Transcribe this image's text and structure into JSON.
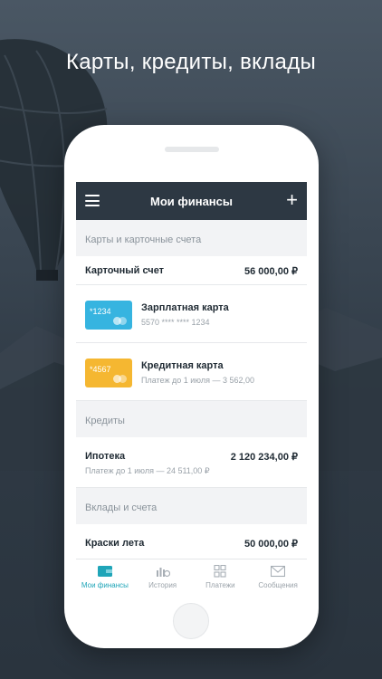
{
  "headline": "Карты, кредиты, вклады",
  "nav": {
    "title": "Мои финансы"
  },
  "sections": {
    "cards_header": "Карты и карточные счета",
    "credits_header": "Кредиты",
    "deposits_header": "Вклады и счета"
  },
  "card_account": {
    "name": "Карточный счет",
    "amount": "56 000,00 ₽"
  },
  "cards": [
    {
      "short": "*1234",
      "title": "Зарплатная карта",
      "sub": "5570 **** **** 1234",
      "color": "#36b4e0"
    },
    {
      "short": "*4567",
      "title": "Кредитная карта",
      "sub": "Платеж до 1 июля — 3 562,00",
      "color": "#f5b731"
    }
  ],
  "credit": {
    "name": "Ипотека",
    "amount": "2 120 234,00 ₽",
    "sub": "Платеж до 1 июля — 24 511,00 ₽"
  },
  "deposit": {
    "name": "Краски лета",
    "amount": "50 000,00 ₽"
  },
  "tabs": [
    {
      "label": "Мои финансы",
      "icon": "wallet-icon",
      "active": true
    },
    {
      "label": "История",
      "icon": "history-chart-icon",
      "active": false
    },
    {
      "label": "Платежи",
      "icon": "grid-icon",
      "active": false
    },
    {
      "label": "Сообщения",
      "icon": "envelope-icon",
      "active": false
    }
  ],
  "colors": {
    "accent": "#1fa5b8",
    "navbar": "#2d3843"
  }
}
